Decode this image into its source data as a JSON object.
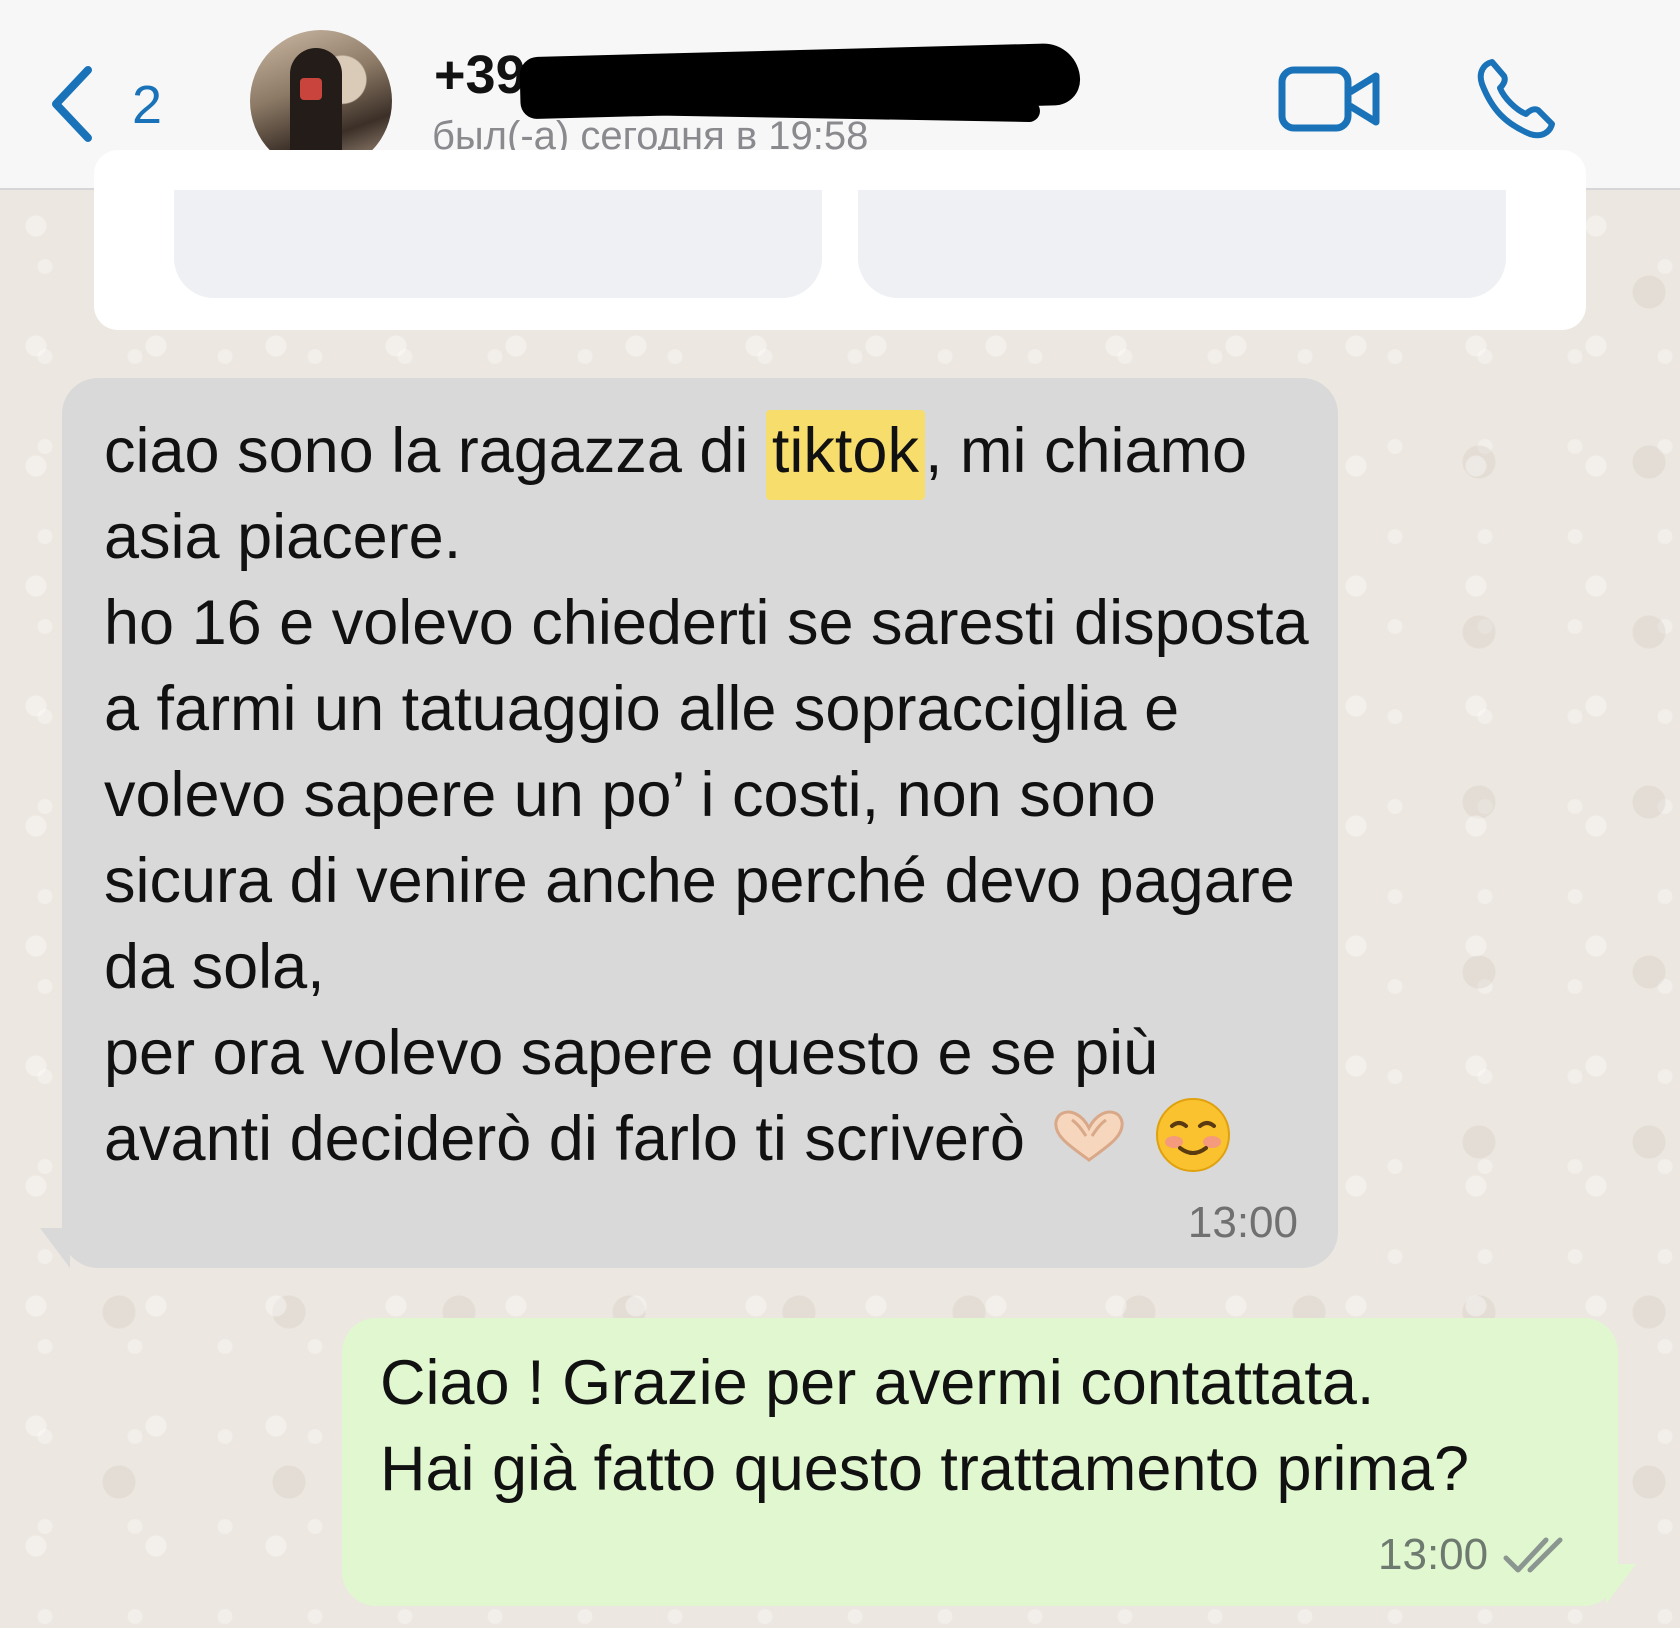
{
  "header": {
    "back_count": "2",
    "contact_name": "+39",
    "last_seen": "был(-а) сегодня в 19:58"
  },
  "icons": {
    "back": "chevron-left-icon",
    "video": "video-camera-icon",
    "call": "phone-icon",
    "ticks": "double-check-icon"
  },
  "colors": {
    "accent": "#1a73b8",
    "incoming_bubble": "#d9d9d9",
    "outgoing_bubble": "#e0f7d0",
    "highlight": "#f7dd6c"
  },
  "messages": {
    "incoming": {
      "line1_before": "ciao sono la ragazza di ",
      "highlight": "tiktok",
      "line1_after": ", mi chiamo asia piacere.",
      "line2": "ho 16 e volevo chiederti se saresti disposta a farmi un tatuaggio alle sopracciglia e volevo sapere un po’ i costi, non sono sicura di venire anche perché devo pagare da sola,",
      "line3": "per ora volevo sapere questo e se più avanti deciderò di farlo ti scriverò",
      "time": "13:00"
    },
    "outgoing": {
      "line1": "Ciao ! Grazie per avermi contattata.",
      "line2": "Hai già fatto questo trattamento prima?",
      "time": "13:00"
    }
  }
}
